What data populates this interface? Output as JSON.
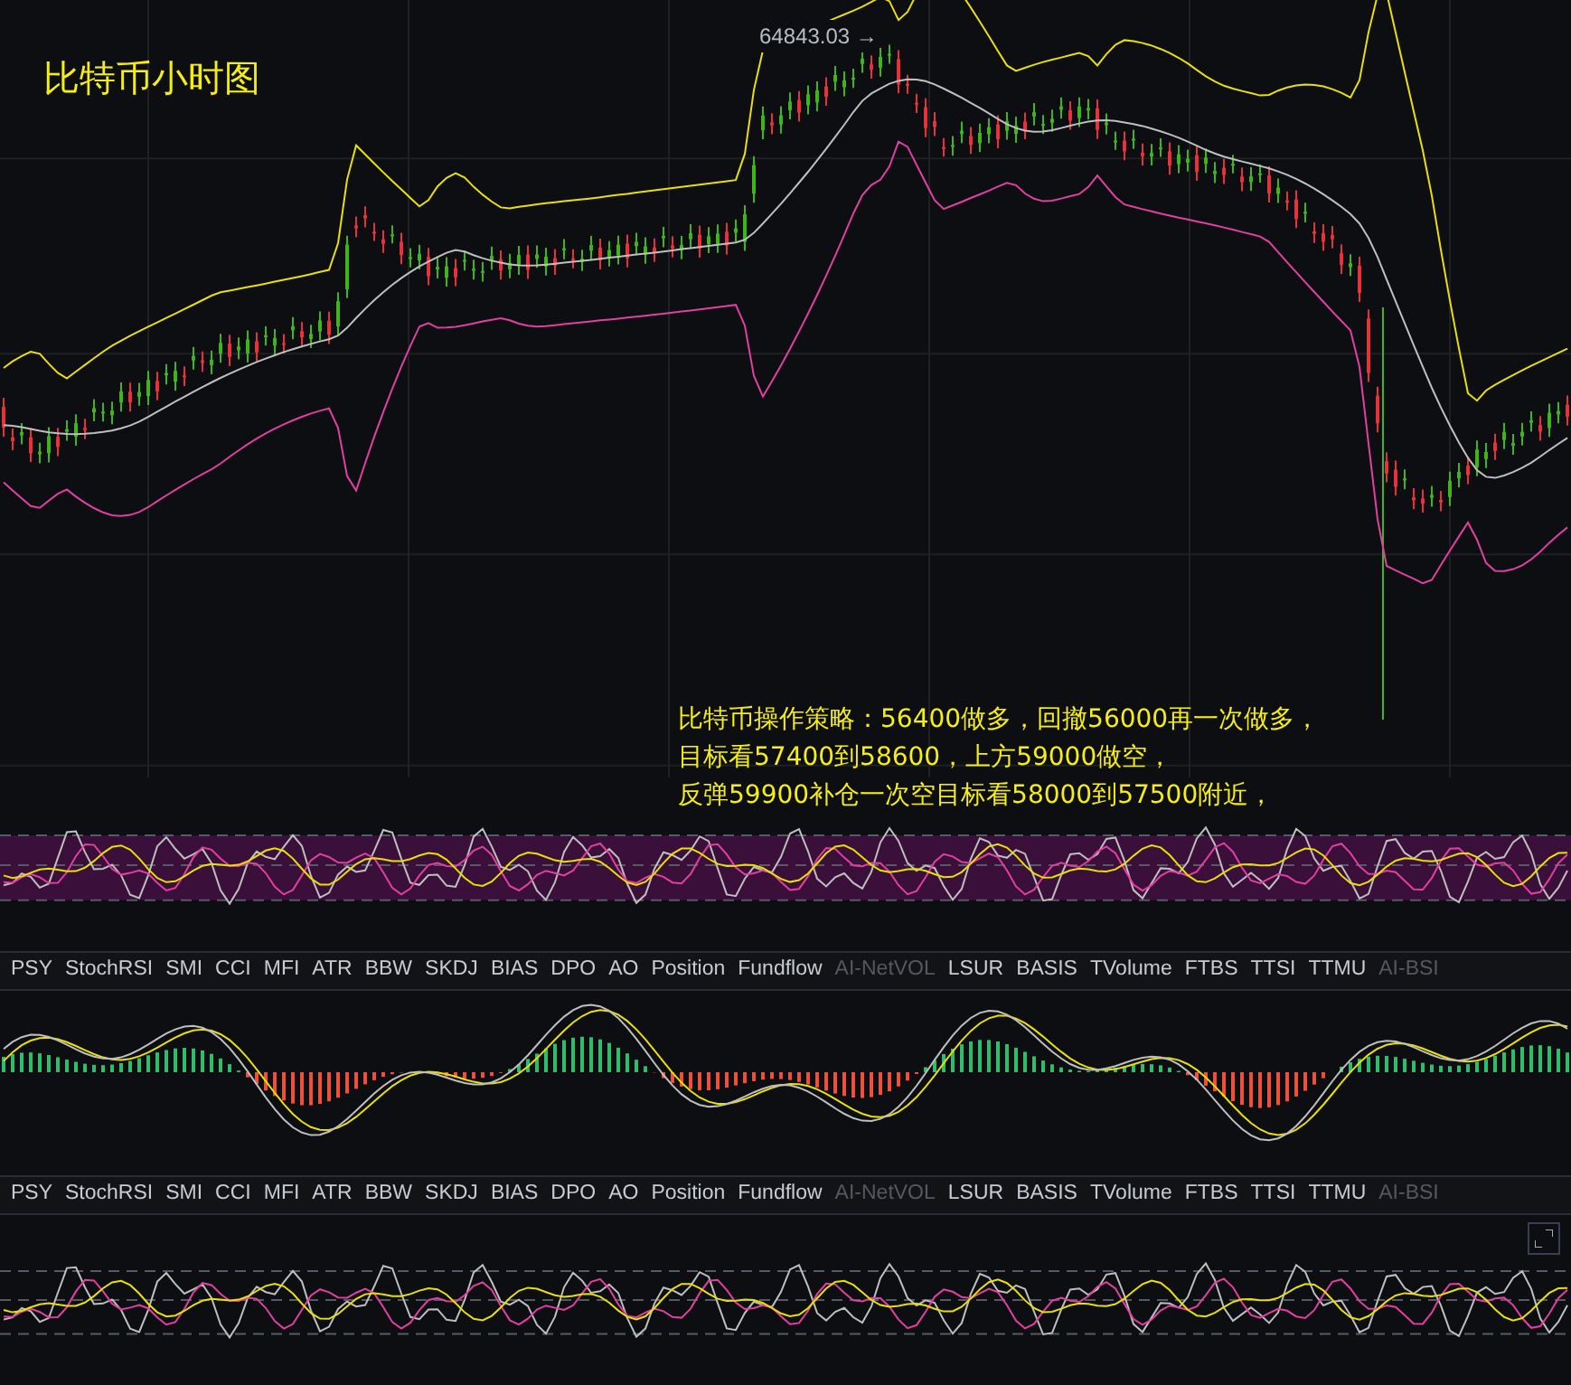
{
  "chart_title": "比特币小时图",
  "high_price_label": "64843.03 →",
  "strategy_note": [
    "比特币操作策略：56400做多，回撤56000再一次做多，",
    "目标看57400到58600，上方59000做空，",
    "反弹59900补仓一次空目标看58000到57500附近，"
  ],
  "indicator_tab_bars": [
    {
      "tabs": [
        {
          "label": "PSY",
          "disabled": false
        },
        {
          "label": "StochRSI",
          "disabled": false
        },
        {
          "label": "SMI",
          "disabled": false
        },
        {
          "label": "CCI",
          "disabled": false
        },
        {
          "label": "MFI",
          "disabled": false
        },
        {
          "label": "ATR",
          "disabled": false
        },
        {
          "label": "BBW",
          "disabled": false
        },
        {
          "label": "SKDJ",
          "disabled": false
        },
        {
          "label": "BIAS",
          "disabled": false
        },
        {
          "label": "DPO",
          "disabled": false
        },
        {
          "label": "AO",
          "disabled": false
        },
        {
          "label": "Position",
          "disabled": false
        },
        {
          "label": "Fundflow",
          "disabled": false
        },
        {
          "label": "AI-NetVOL",
          "disabled": true
        },
        {
          "label": "LSUR",
          "disabled": false
        },
        {
          "label": "BASIS",
          "disabled": false
        },
        {
          "label": "TVolume",
          "disabled": false
        },
        {
          "label": "FTBS",
          "disabled": false
        },
        {
          "label": "TTSI",
          "disabled": false
        },
        {
          "label": "TTMU",
          "disabled": false
        },
        {
          "label": "AI-BSI",
          "disabled": true
        }
      ]
    },
    {
      "tabs": [
        {
          "label": "PSY",
          "disabled": false
        },
        {
          "label": "StochRSI",
          "disabled": false
        },
        {
          "label": "SMI",
          "disabled": false
        },
        {
          "label": "CCI",
          "disabled": false
        },
        {
          "label": "MFI",
          "disabled": false
        },
        {
          "label": "ATR",
          "disabled": false
        },
        {
          "label": "BBW",
          "disabled": false
        },
        {
          "label": "SKDJ",
          "disabled": false
        },
        {
          "label": "BIAS",
          "disabled": false
        },
        {
          "label": "DPO",
          "disabled": false
        },
        {
          "label": "AO",
          "disabled": false
        },
        {
          "label": "Position",
          "disabled": false
        },
        {
          "label": "Fundflow",
          "disabled": false
        },
        {
          "label": "AI-NetVOL",
          "disabled": true
        },
        {
          "label": "LSUR",
          "disabled": false
        },
        {
          "label": "BASIS",
          "disabled": false
        },
        {
          "label": "TVolume",
          "disabled": false
        },
        {
          "label": "FTBS",
          "disabled": false
        },
        {
          "label": "TTSI",
          "disabled": false
        },
        {
          "label": "TTMU",
          "disabled": false
        },
        {
          "label": "AI-BSI",
          "disabled": true
        }
      ]
    }
  ]
}
